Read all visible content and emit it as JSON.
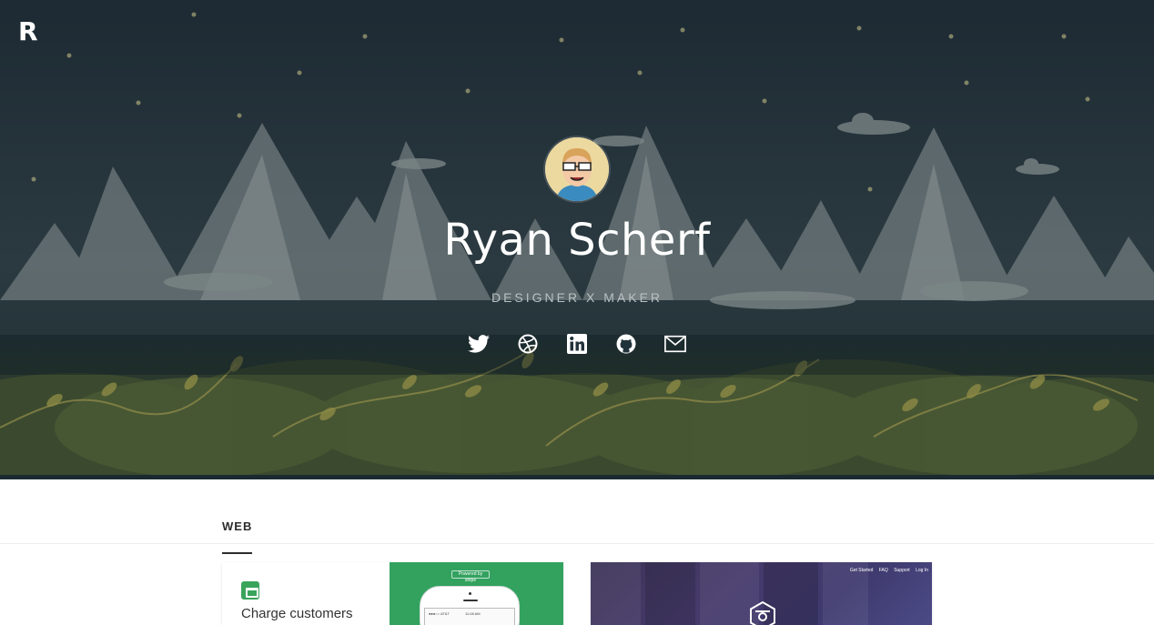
{
  "header": {
    "logo_letter": "R"
  },
  "profile": {
    "name": "Ryan Scherf",
    "tagline": "DESIGNER X MAKER"
  },
  "social": [
    {
      "name": "twitter-icon"
    },
    {
      "name": "dribbble-icon"
    },
    {
      "name": "linkedin-icon"
    },
    {
      "name": "github-icon"
    },
    {
      "name": "email-icon"
    }
  ],
  "section": {
    "active_tab": "WEB"
  },
  "cards": {
    "stripe": {
      "headline": "Charge customers",
      "pill": "Powered by stripe",
      "carrier": "●●●○○ AT&T",
      "time": "11:08 AM"
    },
    "dark": {
      "nav": [
        "Get Started",
        "FAQ",
        "Support",
        "Log In"
      ]
    }
  },
  "colors": {
    "hero_bg": "#26343c",
    "accent_green": "#33a25f",
    "dark_card": "#433a6a",
    "text_dark": "#2c2c2c"
  }
}
